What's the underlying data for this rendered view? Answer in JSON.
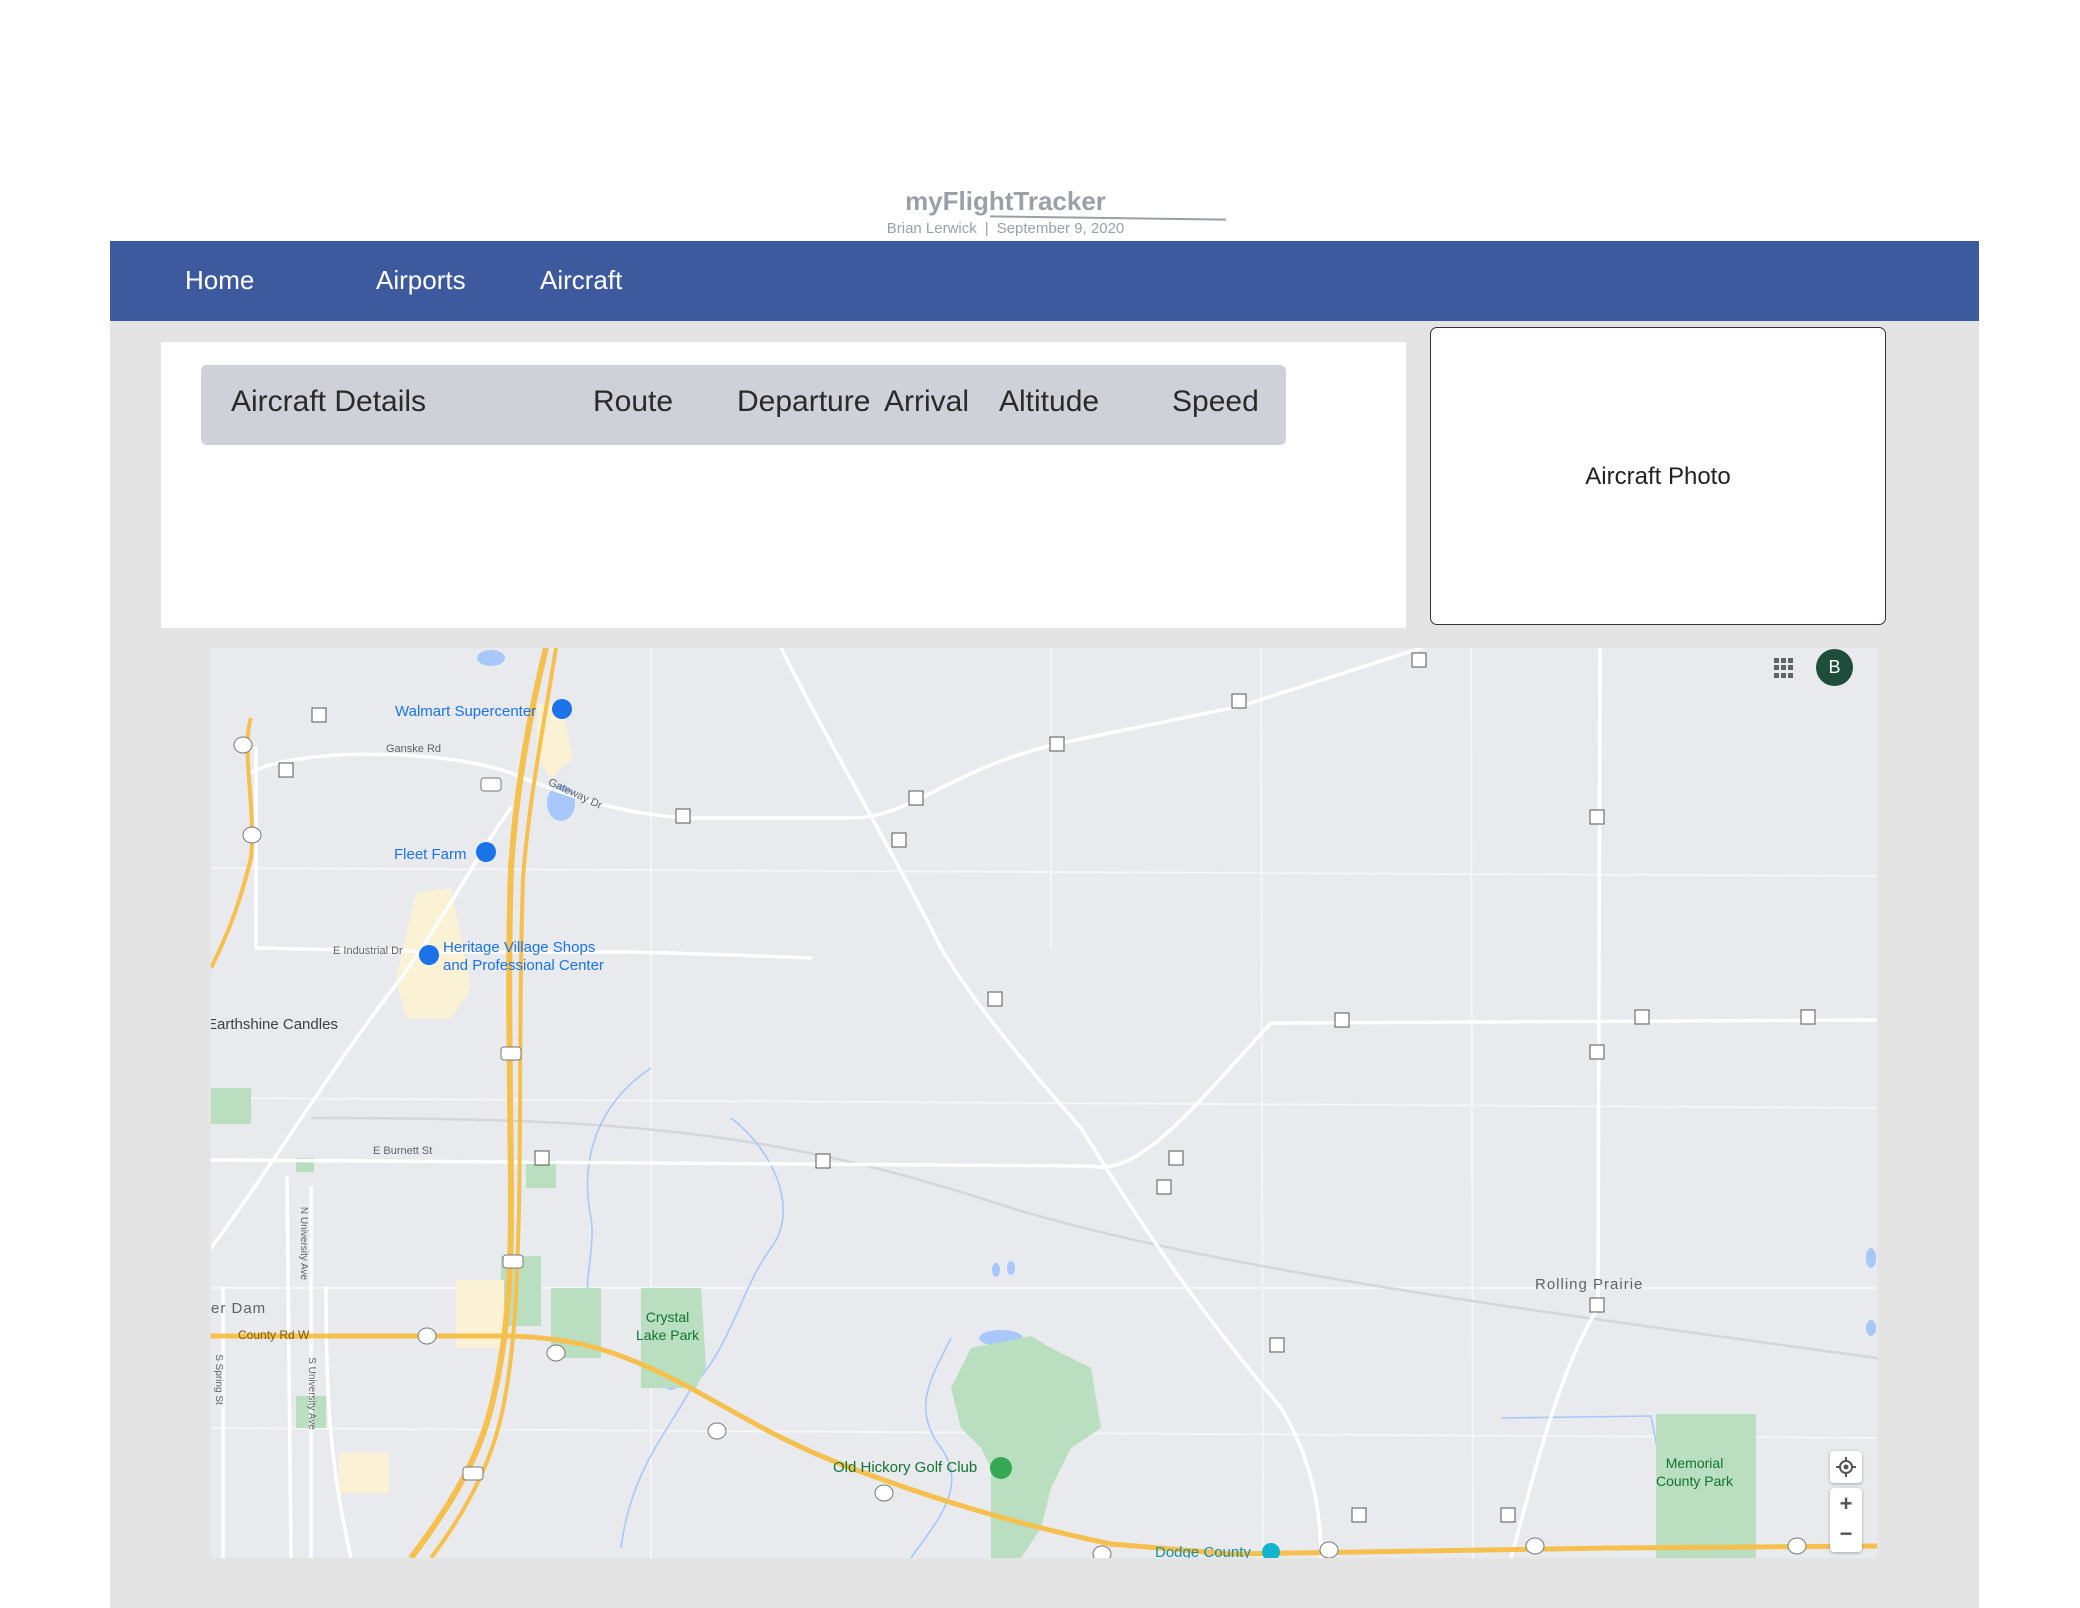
{
  "header": {
    "title": "myFlightTracker",
    "author": "Brian Lerwick",
    "separator": "|",
    "date": "September 9, 2020"
  },
  "nav": {
    "items": [
      {
        "label": "Home"
      },
      {
        "label": "Airports"
      },
      {
        "label": "Aircraft"
      }
    ]
  },
  "details": {
    "columns": [
      "Aircraft Details",
      "Route",
      "Departure",
      "Arrival",
      "Altitude",
      "Speed"
    ]
  },
  "photo": {
    "label": "Aircraft Photo"
  },
  "map": {
    "account_initial": "B",
    "places": {
      "walmart": "Walmart Supercenter",
      "fleet_farm": "Fleet Farm",
      "heritage_line1": "Heritage Village Shops",
      "heritage_line2": "and Professional Center",
      "earthshine": "Earthshine Candles",
      "crystal_line1": "Crystal",
      "crystal_line2": "Lake Park",
      "golf": "Old Hickory Golf Club",
      "rolling": "Rolling Prairie",
      "memorial_line1": "Memorial",
      "memorial_line2": "County Park",
      "dodge": "Dodge County",
      "dam": "er Dam"
    },
    "roads": {
      "ganske": "Ganske Rd",
      "gateway": "Gateway Dr",
      "industrial": "E Industrial Dr",
      "burnett": "E Burnett St",
      "county_w": "County Rd W",
      "n_university": "N University Ave",
      "s_university": "S University Ave",
      "s_spring": "S Spring St"
    },
    "zoom_in": "+",
    "zoom_out": "−"
  },
  "colors": {
    "nav_bg": "#3c5a9d",
    "content_bg": "#e4e4e4",
    "table_header_bg": "#ced1d7",
    "map_bg": "#e8eaed",
    "highway": "#f6c04f",
    "poi_blue": "#1a73e8",
    "park_green": "#b9dfc0",
    "avatar": "#1e4d3b"
  }
}
